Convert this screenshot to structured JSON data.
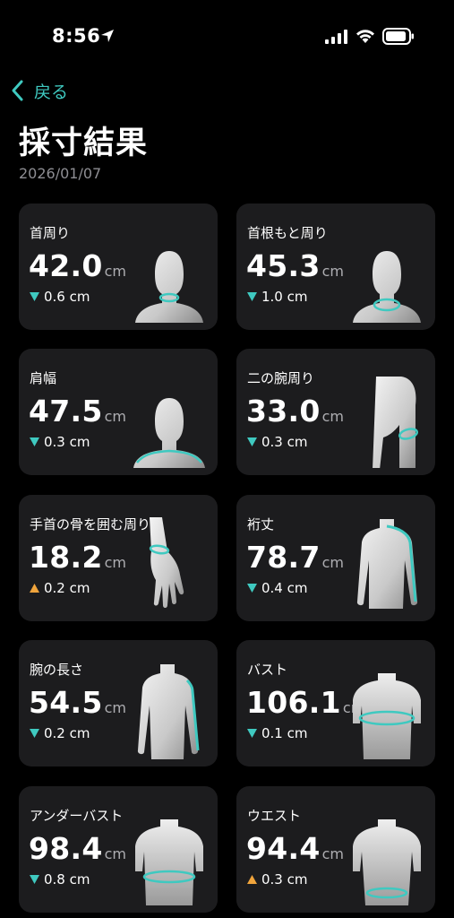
{
  "status": {
    "time": "8:56"
  },
  "nav": {
    "back_label": "戻る"
  },
  "page": {
    "title": "採寸結果",
    "date": "2026/01/07"
  },
  "colors": {
    "accent": "#3fc9c0",
    "down": "#3fc9c0",
    "up": "#f0a43c",
    "card": "#1c1c1e"
  },
  "cards": [
    {
      "name": "首周り",
      "value": "42.0",
      "unit": "cm",
      "delta": "0.6 cm",
      "direction": "down",
      "figure": "neck-figure"
    },
    {
      "name": "首根もと周り",
      "value": "45.3",
      "unit": "cm",
      "delta": "1.0 cm",
      "direction": "down",
      "figure": "neck-base-figure"
    },
    {
      "name": "肩幅",
      "value": "47.5",
      "unit": "cm",
      "delta": "0.3 cm",
      "direction": "down",
      "figure": "shoulder-figure"
    },
    {
      "name": "二の腕周り",
      "value": "33.0",
      "unit": "cm",
      "delta": "0.3 cm",
      "direction": "down",
      "figure": "upper-arm-figure"
    },
    {
      "name": "手首の骨を囲む周り",
      "value": "18.2",
      "unit": "cm",
      "delta": "0.2 cm",
      "direction": "up",
      "figure": "wrist-figure"
    },
    {
      "name": "裄丈",
      "value": "78.7",
      "unit": "cm",
      "delta": "0.4 cm",
      "direction": "down",
      "figure": "sleeve-length-figure"
    },
    {
      "name": "腕の長さ",
      "value": "54.5",
      "unit": "cm",
      "delta": "0.2 cm",
      "direction": "down",
      "figure": "arm-length-figure"
    },
    {
      "name": "バスト",
      "value": "106.1",
      "unit": "cm",
      "delta": "0.1 cm",
      "direction": "down",
      "figure": "bust-figure"
    },
    {
      "name": "アンダーバスト",
      "value": "98.4",
      "unit": "cm",
      "delta": "0.8 cm",
      "direction": "down",
      "figure": "underbust-figure"
    },
    {
      "name": "ウエスト",
      "value": "94.4",
      "unit": "cm",
      "delta": "0.3 cm",
      "direction": "up",
      "figure": "waist-figure"
    }
  ]
}
